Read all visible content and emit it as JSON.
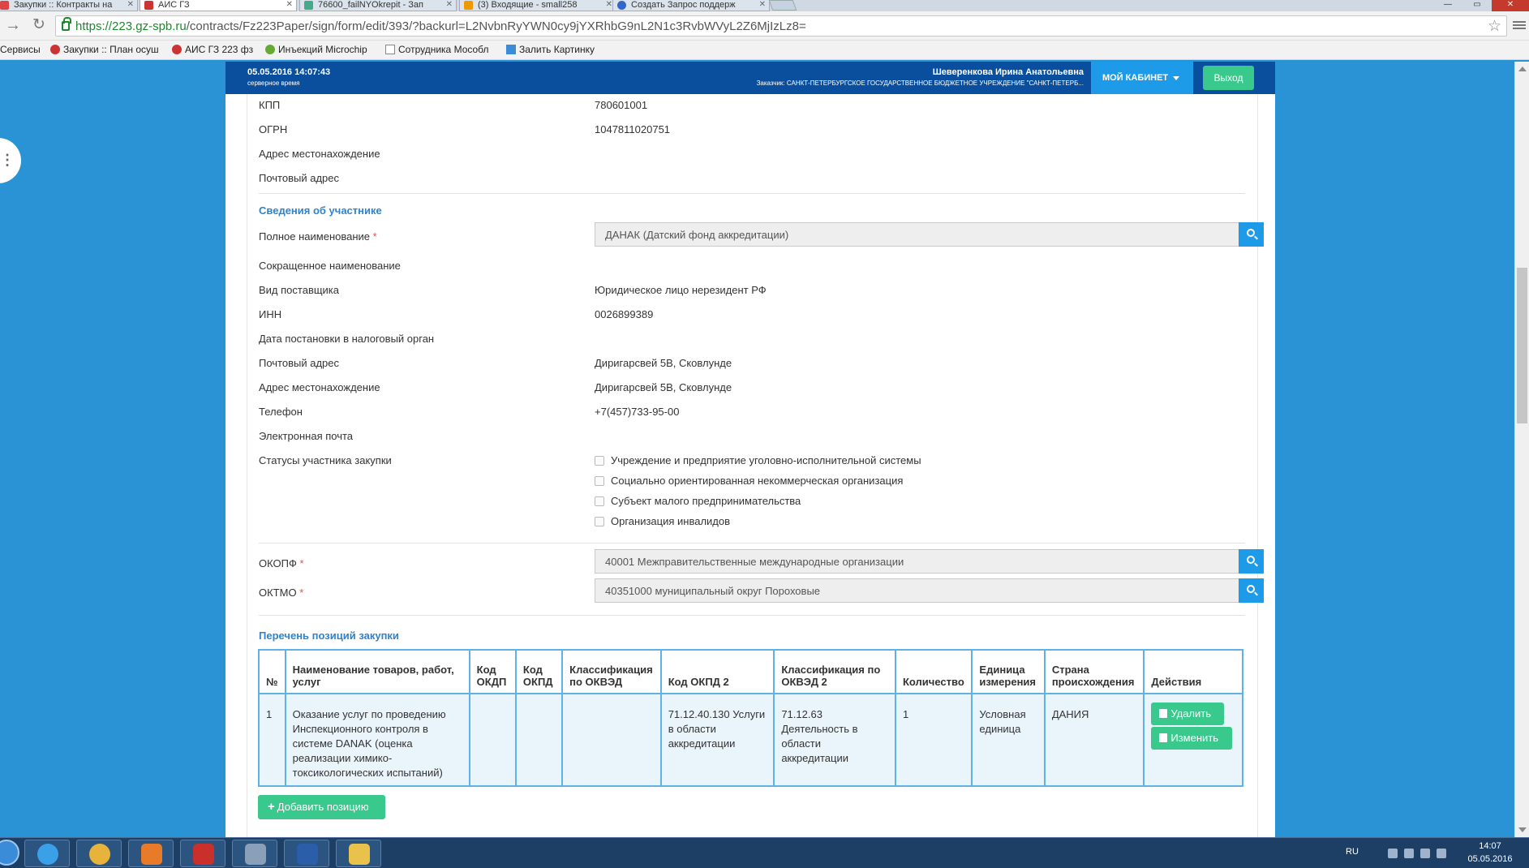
{
  "browser": {
    "tabs": [
      {
        "label": "Закупки :: Контракты на",
        "color": "#d44"
      },
      {
        "label": "АИС ГЗ",
        "color": "#c33"
      },
      {
        "label": "76600_failNYOkrepit - Зап",
        "color": "#4a8"
      },
      {
        "label": "(3) Входящие - small258",
        "color": "#e90"
      },
      {
        "label": "Создать Запрос поддерж",
        "color": "#36c"
      }
    ],
    "url_proto": "https://",
    "url_host": "223.gz-spb.ru",
    "url_path": "/contracts/Fz223Paper/sign/form/edit/393/?backurl=L2NvbnRyYWN0cy9jYXRhbG9nL2N1c3RvbWVyL2Z6MjIzLz8=",
    "bookmarks": [
      {
        "label": "Сервисы",
        "icon": "apps-icon"
      },
      {
        "label": "Закупки :: План осуш",
        "icon": "site-icon"
      },
      {
        "label": "АИС ГЗ 223 фз",
        "icon": "site-icon"
      },
      {
        "label": "Инъекций Microchip",
        "icon": "site-icon"
      },
      {
        "label": "Сотрудника Мособл",
        "icon": "page-icon"
      },
      {
        "label": "Залить Картинку",
        "icon": "site-icon"
      }
    ]
  },
  "header": {
    "date": "05.05.2016 14:07:43",
    "date_sub": "серверное время",
    "user": "Шеверенкова Ирина Анатольевна",
    "org": "Заказчик: САНКТ-ПЕТЕРБУРГСКОЕ ГОСУДАРСТВЕННОЕ БЮДЖЕТНОЕ УЧРЕЖДЕНИЕ \"САНКТ-ПЕТЕРБ...",
    "cabinet": "МОЙ КАБИНЕТ",
    "logout": "Выход"
  },
  "customer": {
    "kpp_label": "КПП",
    "kpp_value": "780601001",
    "ogrn_label": "ОГРН",
    "ogrn_value": "1047811020751",
    "address_label": "Адрес местонахождение",
    "postal_label": "Почтовый адрес"
  },
  "participant": {
    "title": "Сведения об участнике",
    "full_name_label": "Полное наименование",
    "full_name_value": "ДАНАК (Датский фонд аккредитации)",
    "short_name_label": "Сокращенное наименование",
    "supplier_type_label": "Вид поставщика",
    "supplier_type_value": "Юридическое лицо нерезидент РФ",
    "inn_label": "ИНН",
    "inn_value": "0026899389",
    "tax_date_label": "Дата постановки в налоговый орган",
    "postal_label": "Почтовый адрес",
    "postal_value": "Диригарсвей 5В, Сковлунде",
    "address_label": "Адрес местонахождение",
    "address_value": "Диригарсвей 5В, Сковлунде",
    "phone_label": "Телефон",
    "phone_value": "+7(457)733-95-00",
    "email_label": "Электронная почта",
    "statuses_label": "Статусы участника закупки",
    "statuses": [
      "Учреждение и предприятие уголовно-исполнительной системы",
      "Социально ориентированная некоммерческая организация",
      "Субъект малого предпринимательства",
      "Организация инвалидов"
    ],
    "okopf_label": "ОКОПФ",
    "okopf_value": "40001 Межправительственные международные организации",
    "oktmo_label": "ОКТМО",
    "oktmo_value": "40351000 муниципальный округ Пороховые"
  },
  "positions": {
    "title": "Перечень позиций закупки",
    "headers": [
      "№",
      "Наименование товаров, работ, услуг",
      "Код ОКДП",
      "Код ОКПД",
      "Классификация по ОКВЭД",
      "Код ОКПД 2",
      "Классификация по ОКВЭД 2",
      "Количество",
      "Единица измерения",
      "Страна происхождения",
      "Действия"
    ],
    "rows": [
      {
        "num": "1",
        "name": "Оказание услуг по проведению Инспекционного контроля в системе DANAK (оценка реализации химико-токсикологических испытаний)",
        "okdp": "",
        "okpd": "",
        "okved": "",
        "okpd2": "71.12.40.130 Услуги в области аккредитации",
        "okved2": "71.12.63 Деятельность в области аккредитации",
        "qty": "1",
        "unit": "Условная единица",
        "country": "ДАНИЯ"
      }
    ],
    "delete_label": "Удалить",
    "edit_label": "Изменить",
    "add_label": "Добавить позицию"
  },
  "taskbar": {
    "lang": "RU",
    "time": "14:07",
    "date": "05.05.2016",
    "apps": [
      {
        "name": "ie-icon",
        "color": "#3aa0e8"
      },
      {
        "name": "chrome-icon",
        "color": "#e8b33a"
      },
      {
        "name": "media-player-icon",
        "color": "#e87b2a"
      },
      {
        "name": "acrobat-icon",
        "color": "#c9302c"
      },
      {
        "name": "app-icon",
        "color": "#8aa0b8"
      },
      {
        "name": "word-icon",
        "color": "#2b5ea8"
      },
      {
        "name": "explorer-icon",
        "color": "#e8c24a"
      }
    ]
  }
}
